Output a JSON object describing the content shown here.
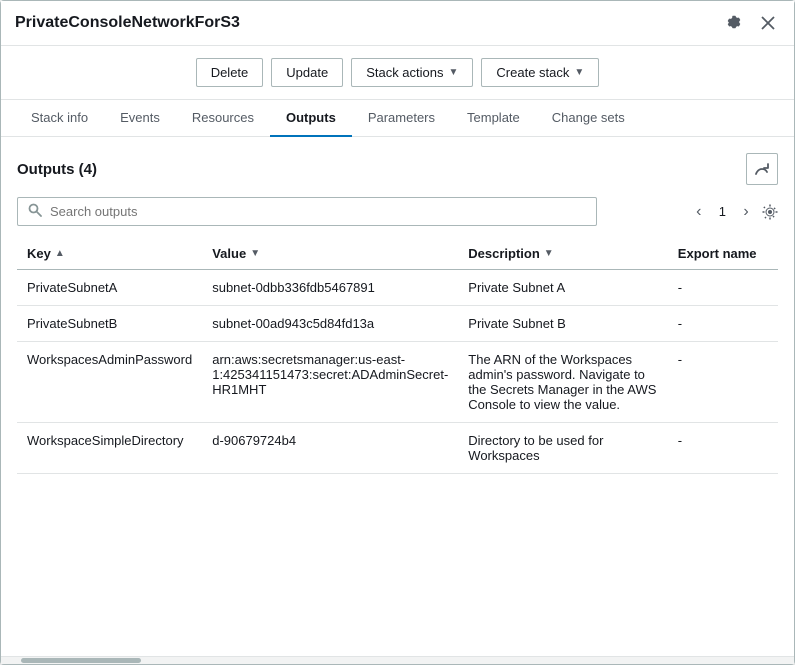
{
  "window": {
    "title": "PrivateConsoleNetworkForS3"
  },
  "toolbar": {
    "delete_label": "Delete",
    "update_label": "Update",
    "stack_actions_label": "Stack actions",
    "create_stack_label": "Create stack"
  },
  "tabs": [
    {
      "id": "stack-info",
      "label": "Stack info",
      "active": false
    },
    {
      "id": "events",
      "label": "Events",
      "active": false
    },
    {
      "id": "resources",
      "label": "Resources",
      "active": false
    },
    {
      "id": "outputs",
      "label": "Outputs",
      "active": true
    },
    {
      "id": "parameters",
      "label": "Parameters",
      "active": false
    },
    {
      "id": "template",
      "label": "Template",
      "active": false
    },
    {
      "id": "change-sets",
      "label": "Change sets",
      "active": false
    }
  ],
  "outputs": {
    "title": "Outputs",
    "count": "(4)",
    "search_placeholder": "Search outputs",
    "page_current": "1",
    "columns": [
      {
        "id": "key",
        "label": "Key",
        "sort": "asc"
      },
      {
        "id": "value",
        "label": "Value",
        "sort": "desc"
      },
      {
        "id": "description",
        "label": "Description",
        "sort": "desc"
      },
      {
        "id": "export_name",
        "label": "Export name",
        "sort": ""
      }
    ],
    "rows": [
      {
        "key": "PrivateSubnetA",
        "value": "subnet-0dbb336fdb5467891",
        "description": "Private Subnet A",
        "export_name": "-"
      },
      {
        "key": "PrivateSubnetB",
        "value": "subnet-00ad943c5d84fd13a",
        "description": "Private Subnet B",
        "export_name": "-"
      },
      {
        "key": "WorkspacesAdminPassword",
        "value": "arn:aws:secretsmanager:us-east-1:425341151473:secret:ADAdminSecret-HR1MHT",
        "description": "The ARN of the Workspaces admin's password. Navigate to the Secrets Manager in the AWS Console to view the value.",
        "export_name": "-"
      },
      {
        "key": "WorkspaceSimpleDirectory",
        "value": "d-90679724b4",
        "description": "Directory to be used for Workspaces",
        "export_name": "-"
      }
    ]
  }
}
